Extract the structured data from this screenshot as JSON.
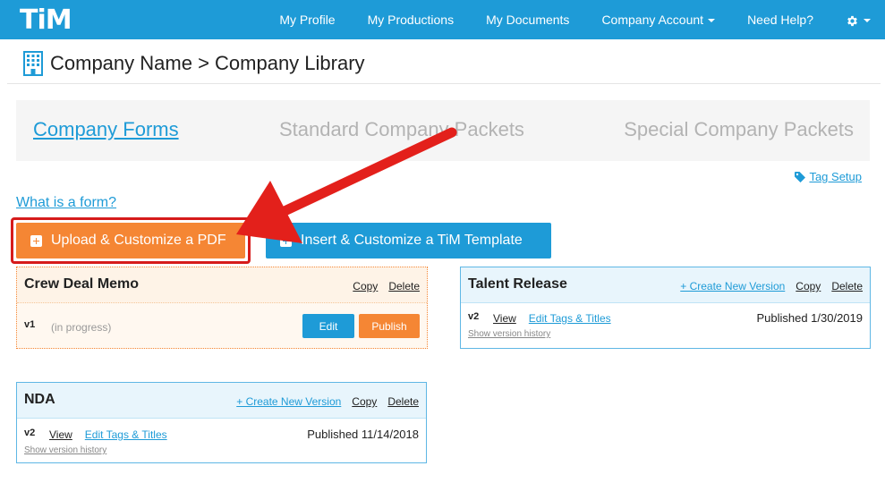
{
  "nav": {
    "logo": "TiM",
    "items": [
      {
        "label": "My Profile"
      },
      {
        "label": "My Productions"
      },
      {
        "label": "My Documents"
      },
      {
        "label": "Company Account"
      },
      {
        "label": "Need Help?"
      }
    ],
    "settings_icon": "gear-icon"
  },
  "header": {
    "title": "Company Name > Company Library",
    "icon": "building-icon"
  },
  "tabs": [
    {
      "label": "Company Forms",
      "active": true
    },
    {
      "label": "Standard Company Packets",
      "active": false
    },
    {
      "label": "Special Company Packets",
      "active": false
    }
  ],
  "tag_setup": {
    "label": "Tag Setup",
    "icon": "tag-icon"
  },
  "what_is_form": "What is a form?",
  "buttons": {
    "upload": "Upload & Customize a PDF",
    "insert": "Insert & Customize a TiM Template"
  },
  "cards": {
    "crew": {
      "title": "Crew Deal Memo",
      "copy": "Copy",
      "delete": "Delete",
      "version": "v1",
      "status": "(in progress)",
      "edit": "Edit",
      "publish": "Publish"
    },
    "talent": {
      "title": "Talent Release",
      "create": "+ Create New Version",
      "copy": "Copy",
      "delete": "Delete",
      "version": "v2",
      "view": "View",
      "edit_tags": "Edit Tags & Titles",
      "published": "Published 1/30/2019",
      "history": "Show version history"
    },
    "nda": {
      "title": "NDA",
      "create": "+ Create New Version",
      "copy": "Copy",
      "delete": "Delete",
      "version": "v2",
      "view": "View",
      "edit_tags": "Edit Tags & Titles",
      "published": "Published 11/14/2018",
      "history": "Show version history"
    }
  },
  "colors": {
    "primary": "#1e9bd7",
    "accent": "#f58634",
    "highlight": "#d61b1b"
  }
}
